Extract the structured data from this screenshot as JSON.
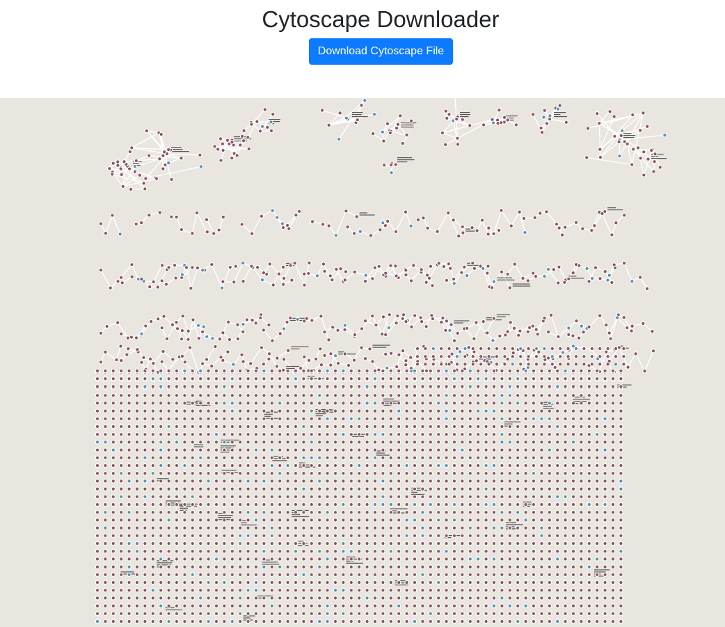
{
  "page": {
    "title": "Cytoscape Downloader"
  },
  "toolbar": {
    "download_label": "Download Cytoscape File"
  },
  "network": {
    "background_color": "#e9e6e0",
    "node_color_primary": "#8a5565",
    "node_color_secondary": "#5b8fb3",
    "edge_color": "#ffffff"
  }
}
